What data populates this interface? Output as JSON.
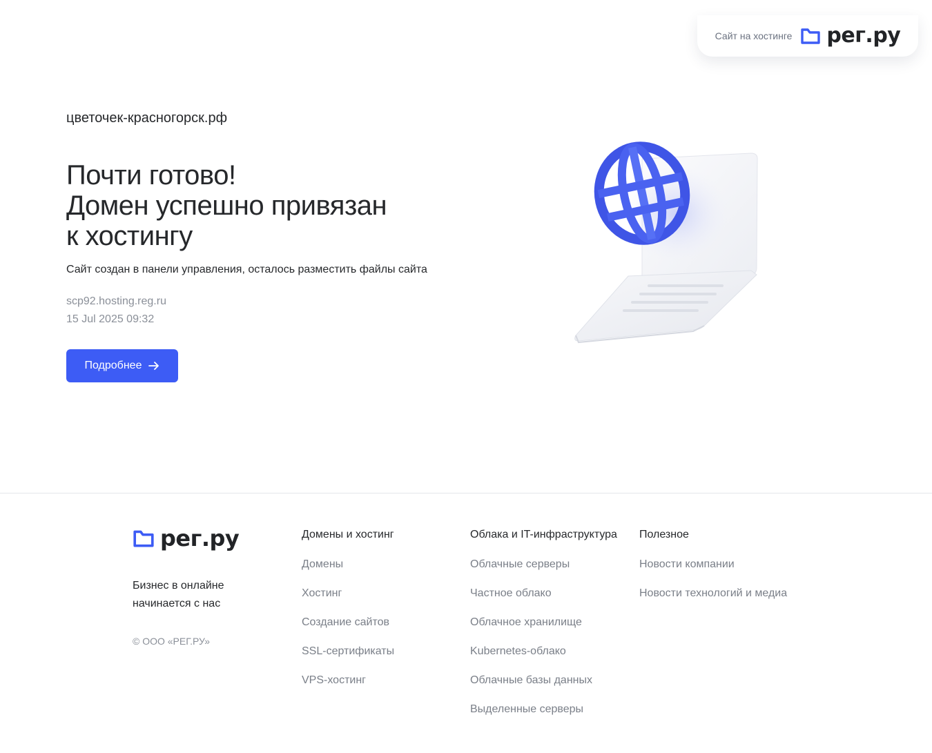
{
  "badge": {
    "text": "Сайт на хостинге",
    "brand": "рег.ру"
  },
  "main": {
    "domain": "цветочек-красногорск.рф",
    "headline": [
      "Почти готово!",
      "Домен успешно привязан",
      "к хостингу"
    ],
    "subtitle": "Сайт создан в панели управления, осталось разместить файлы сайта",
    "server": "scp92.hosting.reg.ru",
    "date": "15 Jul 2025 09:32",
    "button_label": "Подробнее",
    "button_icon": "arrow-right-icon"
  },
  "footer": {
    "brand": "рег.ру",
    "tagline": "Бизнес в онлайне начинается с нас",
    "copyright": "© ООО «РЕГ.РУ»",
    "columns": [
      {
        "title": "Домены и хостинг",
        "links": [
          "Домены",
          "Хостинг",
          "Создание сайтов",
          "SSL-сертификаты",
          "VPS-хостинг"
        ]
      },
      {
        "title": "Облака и IT-инфраструктура",
        "links": [
          "Облачные серверы",
          "Частное облако",
          "Облачное хранилище",
          "Kubernetes-облако",
          "Облачные базы данных",
          "Выделенные серверы"
        ]
      },
      {
        "title": "Полезное",
        "links": [
          "Новости компании",
          "Новости технологий и медиа"
        ]
      }
    ]
  },
  "colors": {
    "accent": "#3d5cf5",
    "text": "#26282b",
    "muted": "#8a8f98"
  }
}
